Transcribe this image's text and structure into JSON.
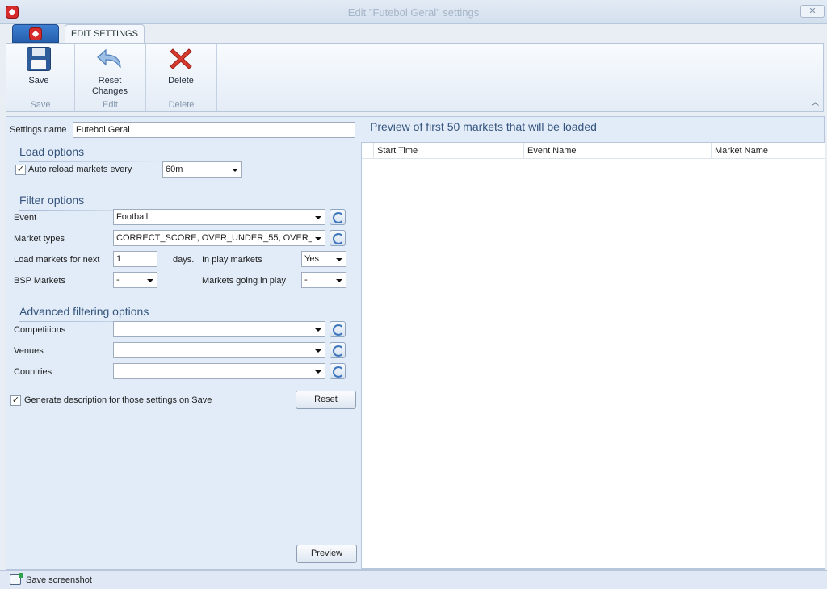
{
  "window": {
    "title": "Edit \"Futebol Geral\" settings",
    "close_label": "✕"
  },
  "ribbon": {
    "tab_label": "EDIT SETTINGS",
    "save_label": "Save",
    "reset_label_1": "Reset",
    "reset_label_2": "Changes",
    "delete_label": "Delete",
    "groups": [
      "Save",
      "Edit",
      "Delete"
    ],
    "collapse_icon": "chevron-up-icon"
  },
  "form": {
    "settings_name_label": "Settings name",
    "settings_name_value": "Futebol Geral",
    "load_options_header": "Load options",
    "auto_reload_label": "Auto reload markets every",
    "auto_reload_checked": true,
    "auto_reload_value": "60m",
    "filter_options_header": "Filter options",
    "event_label": "Event",
    "event_value": "Football",
    "market_types_label": "Market types",
    "market_types_value": "CORRECT_SCORE, OVER_UNDER_55, OVER_U...",
    "load_markets_label": "Load markets for next",
    "load_markets_value": "1",
    "days_label": "days.",
    "in_play_label": "In play markets",
    "in_play_value": "Yes",
    "bsp_label": "BSP Markets",
    "bsp_value": "-",
    "going_in_play_label": "Markets going in play",
    "going_in_play_value": "-",
    "advanced_header": "Advanced filtering options",
    "competitions_label": "Competitions",
    "competitions_value": "",
    "venues_label": "Venues",
    "venues_value": "",
    "countries_label": "Countries",
    "countries_value": "",
    "generate_desc_label": "Generate description for those settings on Save",
    "generate_desc_checked": true,
    "reset_button": "Reset",
    "preview_button": "Preview"
  },
  "preview": {
    "title": "Preview of first 50 markets that will be loaded",
    "columns": [
      "Start Time",
      "Event Name",
      "Market Name"
    ]
  },
  "status": {
    "save_screenshot": "Save screenshot"
  }
}
